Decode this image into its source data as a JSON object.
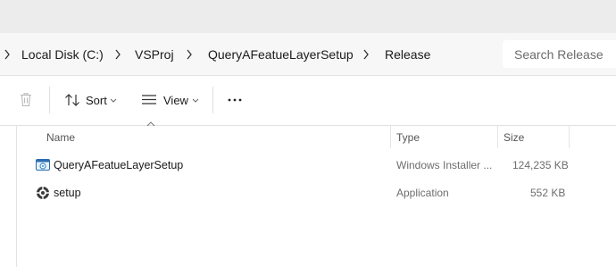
{
  "breadcrumb": {
    "parts": [
      "Local Disk (C:)",
      "VSProj",
      "QueryAFeatueLayerSetup",
      "Release"
    ]
  },
  "search": {
    "placeholder": "Search Release"
  },
  "toolbar": {
    "delete_icon": "trash-icon",
    "sort_label": "Sort",
    "view_label": "View",
    "more_icon": "ellipsis-icon"
  },
  "columns": {
    "name": "Name",
    "type": "Type",
    "size": "Size"
  },
  "files": [
    {
      "name": "QueryAFeatueLayerSetup",
      "type": "Windows Installer ...",
      "size": "124,235 KB",
      "icon": "installer-icon"
    },
    {
      "name": "setup",
      "type": "Application",
      "size": "552 KB",
      "icon": "setup-app-icon"
    }
  ],
  "colors": {
    "accent": "#0067c0",
    "text_secondary": "#6d6d6d"
  }
}
